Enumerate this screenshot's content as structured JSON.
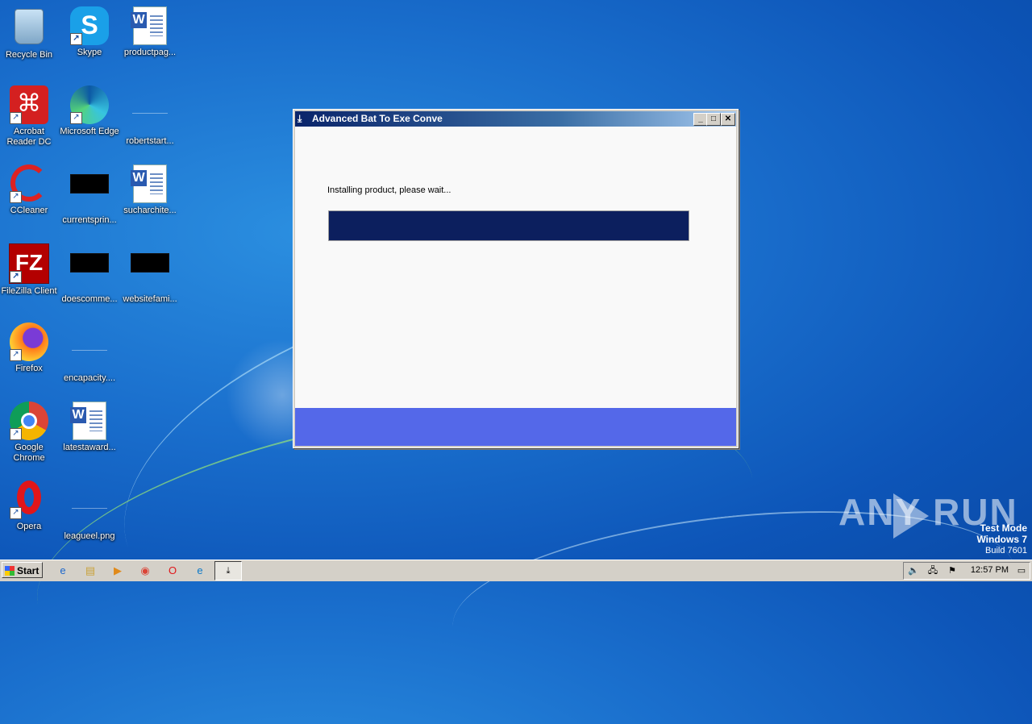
{
  "desktop": {
    "icons": [
      {
        "label": "Recycle Bin"
      },
      {
        "label": "Skype"
      },
      {
        "label": "productpag..."
      },
      {
        "label": "Acrobat Reader DC"
      },
      {
        "label": "Microsoft Edge"
      },
      {
        "label": "robertstart..."
      },
      {
        "label": "CCleaner"
      },
      {
        "label": "currentsprin..."
      },
      {
        "label": "sucharchite..."
      },
      {
        "label": "FileZilla Client"
      },
      {
        "label": "doescomme..."
      },
      {
        "label": "websitefami..."
      },
      {
        "label": "Firefox"
      },
      {
        "label": "encapacity...."
      },
      {
        "label": "Google Chrome"
      },
      {
        "label": "latestaward..."
      },
      {
        "label": "Opera"
      },
      {
        "label": "leagueel.png"
      }
    ]
  },
  "window": {
    "title": "Advanced Bat To Exe Conve",
    "status_text": "Installing product, please wait...",
    "progress_percent": 100,
    "colors": {
      "progress": "#0c1f5e",
      "footer": "#5468e9"
    }
  },
  "watermark": {
    "text": "ANY RUN"
  },
  "os_info": {
    "line1": "Test Mode",
    "line2": "Windows 7",
    "line3": "Build 7601"
  },
  "taskbar": {
    "start_label": "Start",
    "quicklaunch": [
      "ie-icon",
      "explorer-icon",
      "media-player-icon",
      "chrome-icon",
      "opera-icon",
      "edge-icon"
    ],
    "active_task_icon": "installer-icon",
    "tray_icons": [
      "volume-icon",
      "network-icon",
      "action-center-icon"
    ],
    "clock": "12:57 PM"
  }
}
